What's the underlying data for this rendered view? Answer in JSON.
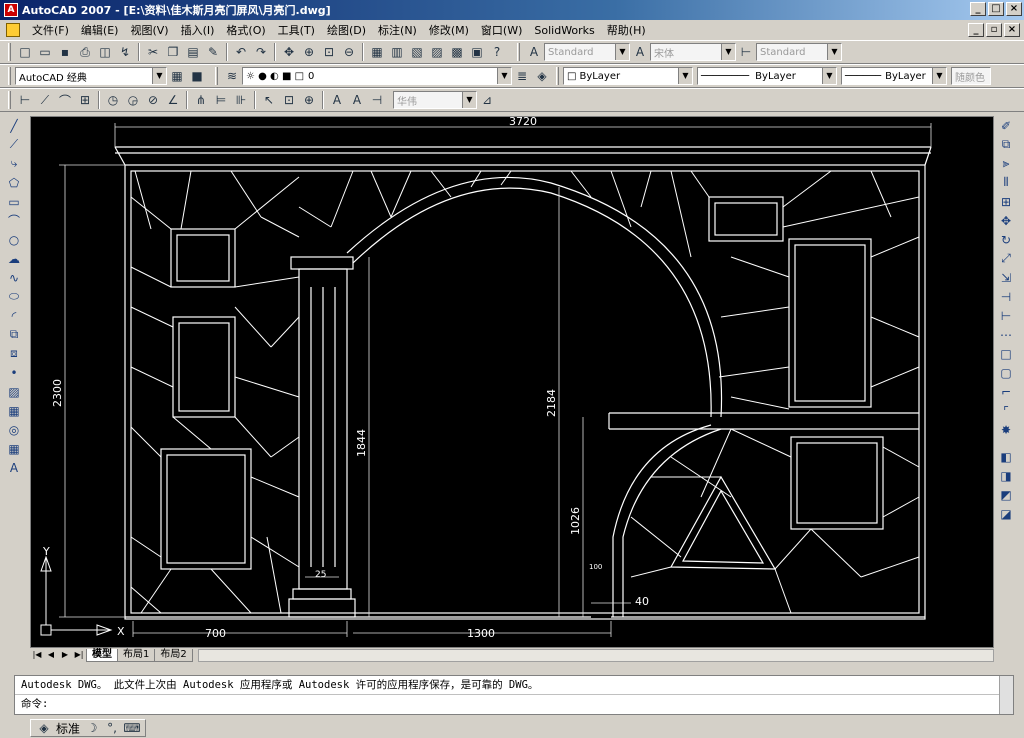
{
  "window": {
    "title": "AutoCAD 2007 - [E:\\资料\\佳木斯月亮门屏风\\月亮门.dwg]",
    "icon_label": "A"
  },
  "menu": [
    "文件(F)",
    "编辑(E)",
    "视图(V)",
    "插入(I)",
    "格式(O)",
    "工具(T)",
    "绘图(D)",
    "标注(N)",
    "修改(M)",
    "窗口(W)",
    "SolidWorks",
    "帮助(H)"
  ],
  "toolbar": {
    "text_style": "Standard",
    "font": "宋体",
    "dim_style": "Standard",
    "workspace": "AutoCAD 经典",
    "layer": "0",
    "color": "ByLayer",
    "linetype": "ByLayer",
    "lineweight": "ByLayer",
    "plot_style": "随颜色",
    "text_font": "华伟"
  },
  "drawing": {
    "dim_total_width": "3720",
    "dim_total_height": "2300",
    "dim_column_height": "1844",
    "dim_arch_height": "2184",
    "dim_lower_height": "1026",
    "dim_left_width": "700",
    "dim_center_width": "1300",
    "dim_small_offset": "40",
    "dim_small_label": "100",
    "dim_column_base": "25",
    "ucs_x": "X",
    "ucs_y": "Y"
  },
  "tabs": [
    "模型",
    "布局1",
    "布局2"
  ],
  "active_tab": "模型",
  "command": {
    "history": "Autodesk DWG。  此文件上次由 Autodesk 应用程序或 Autodesk 许可的应用程序保存，是可靠的 DWG。",
    "prompt": "命令:"
  },
  "status": {
    "ime_mode": "标准"
  }
}
